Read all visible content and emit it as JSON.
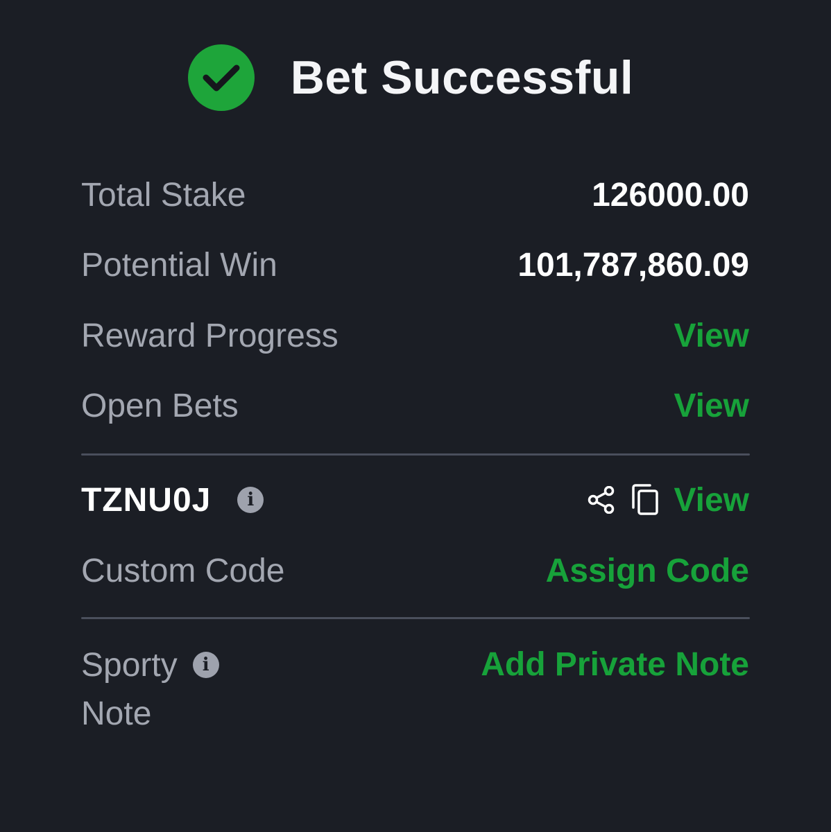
{
  "header": {
    "title": "Bet Successful",
    "icon": "check-circle-icon",
    "accent_color": "#1ea53a"
  },
  "summary": {
    "total_stake_label": "Total Stake",
    "total_stake_value": "126000.00",
    "potential_win_label": "Potential Win",
    "potential_win_value": "101,787,860.09",
    "reward_progress_label": "Reward Progress",
    "reward_progress_link": "View",
    "open_bets_label": "Open Bets",
    "open_bets_link": "View"
  },
  "booking": {
    "code": "TZNU0J",
    "info_icon": "info-icon",
    "share_icon": "share-icon",
    "copy_icon": "copy-icon",
    "view_link": "View",
    "custom_code_label": "Custom Code",
    "assign_code_link": "Assign Code"
  },
  "note": {
    "label_line1": "Sporty",
    "label_line2": "Note",
    "info_icon": "info-icon",
    "add_link": "Add Private Note"
  },
  "colors": {
    "background": "#1b1e25",
    "link_green": "#17a23a",
    "label_gray": "#a3a7b1",
    "value_white": "#ffffff"
  }
}
